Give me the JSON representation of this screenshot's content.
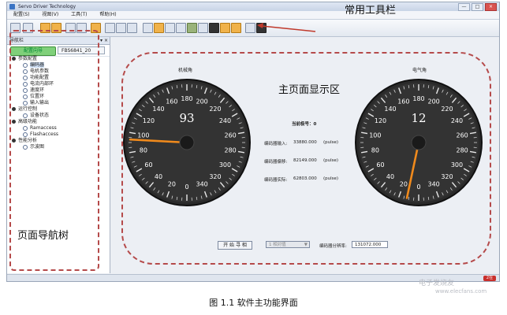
{
  "window": {
    "title": "Servo Driver Technology"
  },
  "menu": [
    {
      "label": "配置(S)"
    },
    {
      "label": "视图(V)"
    },
    {
      "label": "工具(T)"
    },
    {
      "label": "帮助(H)"
    }
  ],
  "window_buttons": [
    "—",
    "□",
    "×"
  ],
  "annotations": {
    "toolbar_label": "常用工具栏",
    "main_label": "主页面显示区",
    "nav_label": "页面导航树"
  },
  "nav": {
    "title": "导航栏",
    "pin": "▾ ×",
    "wizard_button": "配置向导",
    "device_select": "FBS6841_20",
    "tree": [
      {
        "label": "参数配置",
        "level": 0
      },
      {
        "label": "编码器",
        "level": 1,
        "selected": true
      },
      {
        "label": "电机参数",
        "level": 1
      },
      {
        "label": "功能配置",
        "level": 1
      },
      {
        "label": "电流内部环",
        "level": 1
      },
      {
        "label": "速度环",
        "level": 1
      },
      {
        "label": "位置环",
        "level": 1
      },
      {
        "label": "输入输出",
        "level": 1
      },
      {
        "label": "运行控制",
        "level": 0
      },
      {
        "label": "设备状态",
        "level": 1
      },
      {
        "label": "高级功能",
        "level": 0
      },
      {
        "label": "Ramaccess",
        "level": 1
      },
      {
        "label": "Flashaccess",
        "level": 1
      },
      {
        "label": "性能分析",
        "level": 0
      },
      {
        "label": "示波图",
        "level": 1
      }
    ]
  },
  "gauges": {
    "ticks": [
      "0",
      "20",
      "40",
      "60",
      "80",
      "100",
      "120",
      "140",
      "160",
      "180",
      "200",
      "220",
      "240",
      "260",
      "280",
      "300",
      "320",
      "340"
    ],
    "left": {
      "caption": "机械角",
      "value": "93",
      "needle": 93
    },
    "right": {
      "caption": "电气角",
      "value": "12",
      "needle": 12
    }
  },
  "readouts": {
    "pole_label": "当前极号：0",
    "rows": [
      {
        "label": "编码器输入:",
        "value": "33880.000",
        "unit": "(pulse)"
      },
      {
        "label": "编码器偏移:",
        "value": "82149.000",
        "unit": "(pulse)"
      },
      {
        "label": "编码器实际:",
        "value": "62803.000",
        "unit": "(pulse)"
      }
    ]
  },
  "controls": {
    "start_button": "开 始 寻 相",
    "mode_select": "1 相对值",
    "resolution_label": "编码器分辨率:",
    "resolution_value": "131072.000"
  },
  "status": {
    "badge": "2在"
  },
  "watermark": {
    "text": "电子发烧友",
    "url": "www.elecfans.com"
  },
  "caption": "图 1.1  软件主功能界面"
}
